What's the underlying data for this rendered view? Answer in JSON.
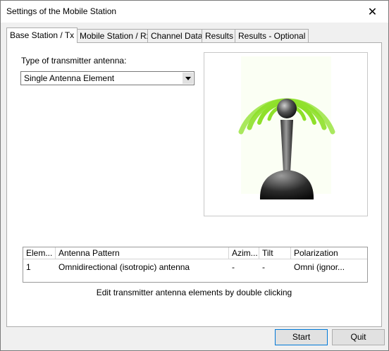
{
  "window": {
    "title": "Settings of the Mobile Station",
    "close_glyph": "✕"
  },
  "tabs": [
    {
      "label": "Base Station / Tx"
    },
    {
      "label": "Mobile Station / Rx"
    },
    {
      "label": "Channel Data"
    },
    {
      "label": "Results"
    },
    {
      "label": "Results - Optional"
    }
  ],
  "antenna": {
    "type_label": "Type of transmitter antenna:",
    "selected_type": "Single Antenna Element",
    "image_icon": "antenna-signal-icon"
  },
  "table": {
    "headers": [
      "Elem...",
      "Antenna Pattern",
      "Azim...",
      "Tilt",
      "Polarization"
    ],
    "rows": [
      [
        "1",
        "Omnidirectional (isotropic) antenna",
        "-",
        "-",
        "Omni (ignor..."
      ]
    ]
  },
  "hint": "Edit transmitter antenna elements by double clicking",
  "buttons": {
    "start": "Start",
    "quit": "Quit"
  },
  "colors": {
    "signal_green": "#8ee02a",
    "accent": "#0078d7"
  }
}
